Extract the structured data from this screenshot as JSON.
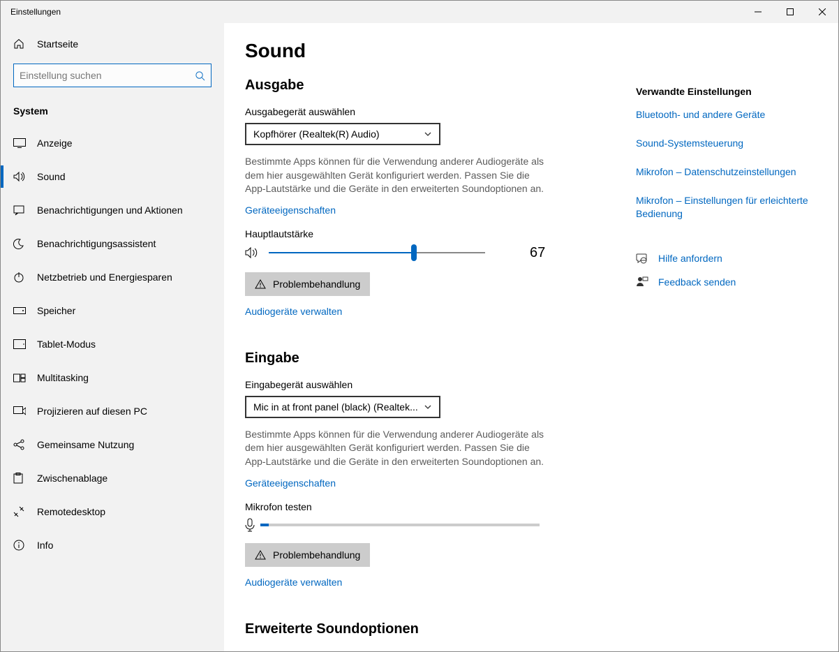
{
  "window": {
    "title": "Einstellungen"
  },
  "sidebar": {
    "home": "Startseite",
    "search_placeholder": "Einstellung suchen",
    "category": "System",
    "items": [
      {
        "label": "Anzeige"
      },
      {
        "label": "Sound"
      },
      {
        "label": "Benachrichtigungen und Aktionen"
      },
      {
        "label": "Benachrichtigungsassistent"
      },
      {
        "label": "Netzbetrieb und Energiesparen"
      },
      {
        "label": "Speicher"
      },
      {
        "label": "Tablet-Modus"
      },
      {
        "label": "Multitasking"
      },
      {
        "label": "Projizieren auf diesen PC"
      },
      {
        "label": "Gemeinsame Nutzung"
      },
      {
        "label": "Zwischenablage"
      },
      {
        "label": "Remotedesktop"
      },
      {
        "label": "Info"
      }
    ]
  },
  "page": {
    "title": "Sound"
  },
  "output": {
    "section_title": "Ausgabe",
    "choose_label": "Ausgabegerät auswählen",
    "device": "Kopfhörer (Realtek(R) Audio)",
    "description": "Bestimmte Apps können für die Verwendung anderer Audiogeräte als dem hier ausgewählten Gerät konfiguriert werden. Passen Sie die App-Lautstärke und die Geräte in den erweiterten Soundoptionen an.",
    "device_properties": "Geräteeigenschaften",
    "volume_label": "Hauptlautstärke",
    "volume_value": "67",
    "troubleshoot": "Problembehandlung",
    "manage": "Audiogeräte verwalten"
  },
  "input": {
    "section_title": "Eingabe",
    "choose_label": "Eingabegerät auswählen",
    "device": "Mic in at front panel (black) (Realtek...",
    "description": "Bestimmte Apps können für die Verwendung anderer Audiogeräte als dem hier ausgewählten Gerät konfiguriert werden. Passen Sie die App-Lautstärke und die Geräte in den erweiterten Soundoptionen an.",
    "device_properties": "Geräteeigenschaften",
    "test_label": "Mikrofon testen",
    "troubleshoot": "Problembehandlung",
    "manage": "Audiogeräte verwalten"
  },
  "advanced": {
    "section_title": "Erweiterte Soundoptionen"
  },
  "related": {
    "title": "Verwandte Einstellungen",
    "links": [
      "Bluetooth- und andere Geräte",
      "Sound-Systemsteuerung",
      "Mikrofon – Datenschutzeinstellungen",
      "Mikrofon – Einstellungen für erleichterte Bedienung"
    ],
    "help": "Hilfe anfordern",
    "feedback": "Feedback senden"
  }
}
